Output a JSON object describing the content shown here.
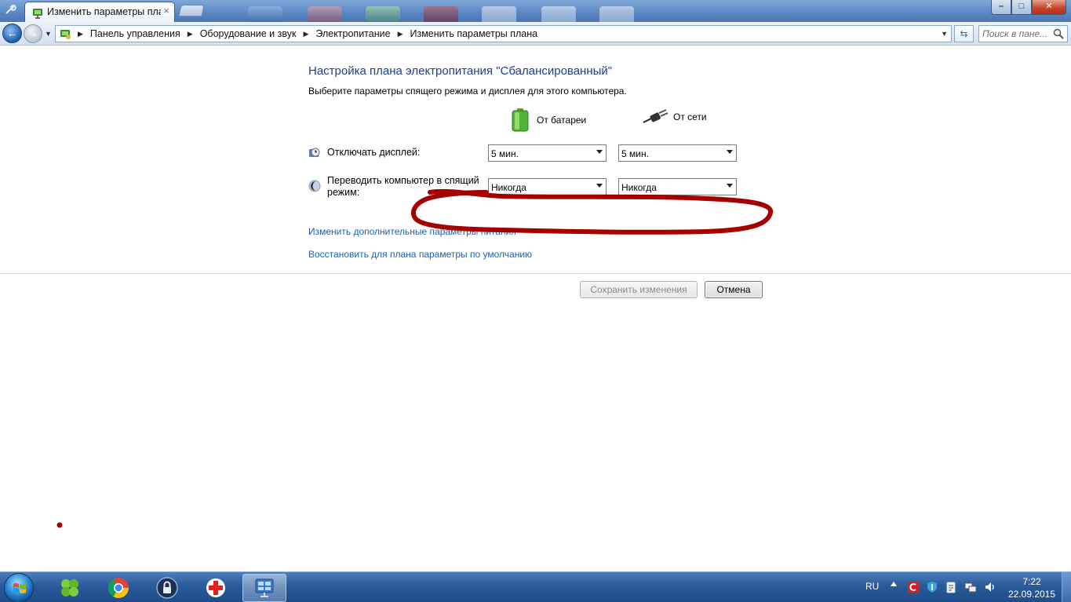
{
  "window": {
    "tab_title": "Изменить параметры плана",
    "tab_close": "×",
    "buttons": {
      "minimize": "–",
      "maximize": "□",
      "close": "✕"
    }
  },
  "navigation": {
    "breadcrumbs": [
      "Панель управления",
      "Оборудование и звук",
      "Электропитание",
      "Изменить параметры плана"
    ],
    "search_placeholder": "Поиск в пане..."
  },
  "page": {
    "title": "Настройка плана электропитания \"Сбалансированный\"",
    "subtitle": "Выберите параметры спящего режима и дисплея для этого компьютера.",
    "columns": {
      "battery": "От батареи",
      "plugged": "От сети"
    },
    "settings": [
      {
        "label": "Отключать дисплей:",
        "battery_value": "5 мин.",
        "plugged_value": "5 мин."
      },
      {
        "label_line1": "Переводить компьютер в спящий",
        "label_line2": "режим:",
        "battery_value": "Никогда",
        "plugged_value": "Никогда"
      }
    ],
    "links": {
      "advanced": "Изменить дополнительные параметры питания",
      "restore": "Восстановить для плана параметры по умолчанию"
    },
    "buttons": {
      "save": "Сохранить изменения",
      "cancel": "Отмена"
    }
  },
  "annotation": {
    "color": "#a50000"
  },
  "taskbar": {
    "language": "RU",
    "clock": {
      "time": "7:22",
      "date": "22.09.2015"
    },
    "apps": [
      "clover-icon",
      "chrome-icon",
      "vpn-lock-icon",
      "red-cross-icon",
      "control-panel-icon"
    ]
  },
  "colors": {
    "title_blue": "#1e3e8c",
    "link_blue": "#1e5fb5",
    "taskbar": "#2a5a99"
  }
}
